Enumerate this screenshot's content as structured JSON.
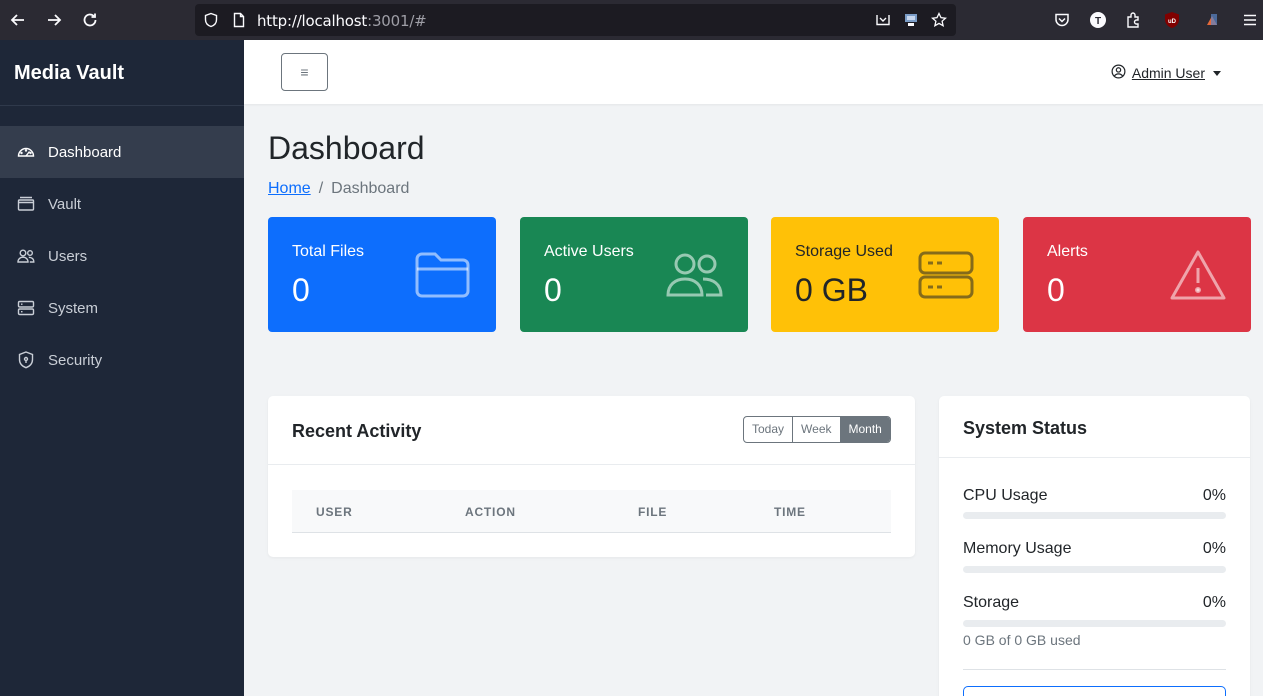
{
  "browser": {
    "url_host": "http://localhost",
    "url_rest": ":3001/#"
  },
  "sidebar": {
    "brand": "Media Vault",
    "items": [
      {
        "label": "Dashboard",
        "icon": "speedometer-icon",
        "active": true
      },
      {
        "label": "Vault",
        "icon": "safe-icon",
        "active": false
      },
      {
        "label": "Users",
        "icon": "people-icon",
        "active": false
      },
      {
        "label": "System",
        "icon": "server-icon",
        "active": false
      },
      {
        "label": "Security",
        "icon": "shield-icon",
        "active": false
      }
    ]
  },
  "header": {
    "toggle_icon": "≡",
    "user_name": "Admin User"
  },
  "page": {
    "title": "Dashboard",
    "breadcrumb": {
      "home": "Home",
      "separator": "/",
      "current": "Dashboard"
    }
  },
  "stats": [
    {
      "label": "Total Files",
      "value": "0",
      "icon": "folder-icon",
      "color": "#0d6efd",
      "text_color": "#ffffff"
    },
    {
      "label": "Active Users",
      "value": "0",
      "icon": "people-icon",
      "color": "#198754",
      "text_color": "#ffffff"
    },
    {
      "label": "Storage Used",
      "value": "0 GB",
      "icon": "server-icon",
      "color": "#ffc107",
      "text_color": "#212529"
    },
    {
      "label": "Alerts",
      "value": "0",
      "icon": "warning-icon",
      "color": "#dc3545",
      "text_color": "#ffffff"
    }
  ],
  "recent_activity": {
    "title": "Recent Activity",
    "filters": [
      "Today",
      "Week",
      "Month"
    ],
    "active_filter": "Month",
    "columns": [
      "USER",
      "ACTION",
      "FILE",
      "TIME"
    ],
    "rows": []
  },
  "system_status": {
    "title": "System Status",
    "metrics": [
      {
        "label": "CPU Usage",
        "value": "0%",
        "percent": 0
      },
      {
        "label": "Memory Usage",
        "value": "0%",
        "percent": 0
      },
      {
        "label": "Storage",
        "value": "0%",
        "percent": 0
      }
    ],
    "storage_note": "0 GB of 0 GB used"
  }
}
